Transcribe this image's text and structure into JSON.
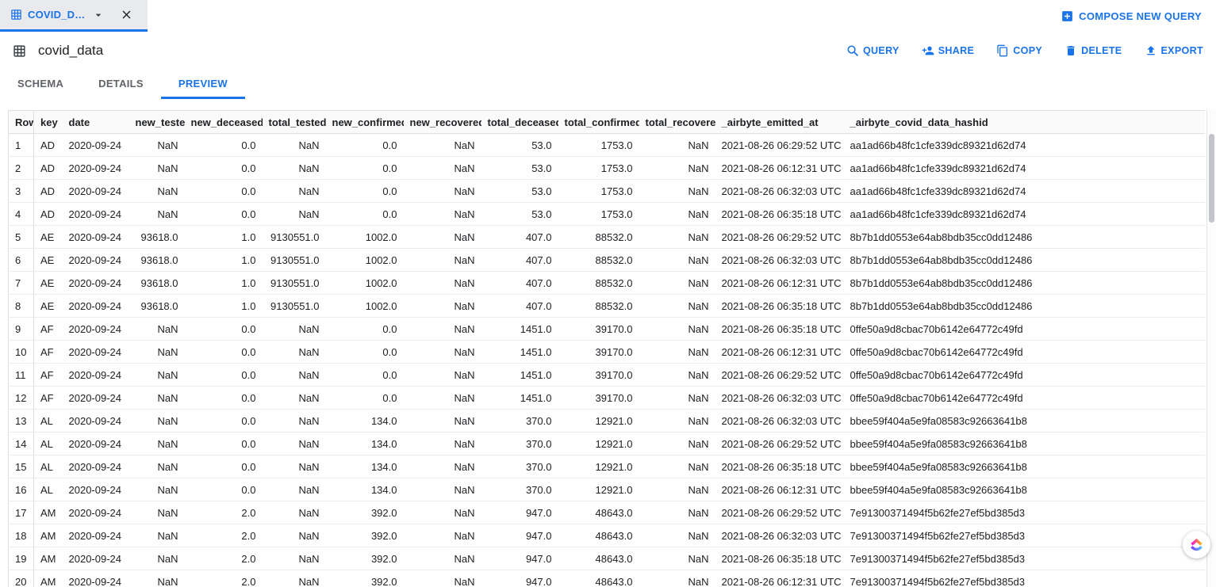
{
  "colors": {
    "accent": "#1a73e8"
  },
  "tab_bar": {
    "tab_label": "COVID_D…",
    "compose_label": "COMPOSE NEW QUERY"
  },
  "header": {
    "title": "covid_data",
    "actions": {
      "query": "QUERY",
      "share": "SHARE",
      "copy": "COPY",
      "delete": "DELETE",
      "export": "EXPORT"
    }
  },
  "nav_tabs": {
    "schema": "SCHEMA",
    "details": "DETAILS",
    "preview": "PREVIEW",
    "active": "PREVIEW"
  },
  "table": {
    "columns": [
      "Row",
      "key",
      "date",
      "new_tested",
      "new_deceased",
      "total_tested",
      "new_confirmed",
      "new_recovered",
      "total_deceased",
      "total_confirmed",
      "total_recovered",
      "_airbyte_emitted_at",
      "_airbyte_covid_data_hashid"
    ],
    "rows": [
      [
        "1",
        "AD",
        "2020-09-24",
        "NaN",
        "0.0",
        "NaN",
        "0.0",
        "NaN",
        "53.0",
        "1753.0",
        "NaN",
        "2021-08-26 06:29:52 UTC",
        "aa1ad66b48fc1cfe339dc89321d62d74"
      ],
      [
        "2",
        "AD",
        "2020-09-24",
        "NaN",
        "0.0",
        "NaN",
        "0.0",
        "NaN",
        "53.0",
        "1753.0",
        "NaN",
        "2021-08-26 06:12:31 UTC",
        "aa1ad66b48fc1cfe339dc89321d62d74"
      ],
      [
        "3",
        "AD",
        "2020-09-24",
        "NaN",
        "0.0",
        "NaN",
        "0.0",
        "NaN",
        "53.0",
        "1753.0",
        "NaN",
        "2021-08-26 06:32:03 UTC",
        "aa1ad66b48fc1cfe339dc89321d62d74"
      ],
      [
        "4",
        "AD",
        "2020-09-24",
        "NaN",
        "0.0",
        "NaN",
        "0.0",
        "NaN",
        "53.0",
        "1753.0",
        "NaN",
        "2021-08-26 06:35:18 UTC",
        "aa1ad66b48fc1cfe339dc89321d62d74"
      ],
      [
        "5",
        "AE",
        "2020-09-24",
        "93618.0",
        "1.0",
        "9130551.0",
        "1002.0",
        "NaN",
        "407.0",
        "88532.0",
        "NaN",
        "2021-08-26 06:29:52 UTC",
        "8b7b1dd0553e64ab8bdb35cc0dd12486"
      ],
      [
        "6",
        "AE",
        "2020-09-24",
        "93618.0",
        "1.0",
        "9130551.0",
        "1002.0",
        "NaN",
        "407.0",
        "88532.0",
        "NaN",
        "2021-08-26 06:32:03 UTC",
        "8b7b1dd0553e64ab8bdb35cc0dd12486"
      ],
      [
        "7",
        "AE",
        "2020-09-24",
        "93618.0",
        "1.0",
        "9130551.0",
        "1002.0",
        "NaN",
        "407.0",
        "88532.0",
        "NaN",
        "2021-08-26 06:12:31 UTC",
        "8b7b1dd0553e64ab8bdb35cc0dd12486"
      ],
      [
        "8",
        "AE",
        "2020-09-24",
        "93618.0",
        "1.0",
        "9130551.0",
        "1002.0",
        "NaN",
        "407.0",
        "88532.0",
        "NaN",
        "2021-08-26 06:35:18 UTC",
        "8b7b1dd0553e64ab8bdb35cc0dd12486"
      ],
      [
        "9",
        "AF",
        "2020-09-24",
        "NaN",
        "0.0",
        "NaN",
        "0.0",
        "NaN",
        "1451.0",
        "39170.0",
        "NaN",
        "2021-08-26 06:35:18 UTC",
        "0ffe50a9d8cbac70b6142e64772c49fd"
      ],
      [
        "10",
        "AF",
        "2020-09-24",
        "NaN",
        "0.0",
        "NaN",
        "0.0",
        "NaN",
        "1451.0",
        "39170.0",
        "NaN",
        "2021-08-26 06:12:31 UTC",
        "0ffe50a9d8cbac70b6142e64772c49fd"
      ],
      [
        "11",
        "AF",
        "2020-09-24",
        "NaN",
        "0.0",
        "NaN",
        "0.0",
        "NaN",
        "1451.0",
        "39170.0",
        "NaN",
        "2021-08-26 06:29:52 UTC",
        "0ffe50a9d8cbac70b6142e64772c49fd"
      ],
      [
        "12",
        "AF",
        "2020-09-24",
        "NaN",
        "0.0",
        "NaN",
        "0.0",
        "NaN",
        "1451.0",
        "39170.0",
        "NaN",
        "2021-08-26 06:32:03 UTC",
        "0ffe50a9d8cbac70b6142e64772c49fd"
      ],
      [
        "13",
        "AL",
        "2020-09-24",
        "NaN",
        "0.0",
        "NaN",
        "134.0",
        "NaN",
        "370.0",
        "12921.0",
        "NaN",
        "2021-08-26 06:32:03 UTC",
        "bbee59f404a5e9fa08583c92663641b8"
      ],
      [
        "14",
        "AL",
        "2020-09-24",
        "NaN",
        "0.0",
        "NaN",
        "134.0",
        "NaN",
        "370.0",
        "12921.0",
        "NaN",
        "2021-08-26 06:29:52 UTC",
        "bbee59f404a5e9fa08583c92663641b8"
      ],
      [
        "15",
        "AL",
        "2020-09-24",
        "NaN",
        "0.0",
        "NaN",
        "134.0",
        "NaN",
        "370.0",
        "12921.0",
        "NaN",
        "2021-08-26 06:35:18 UTC",
        "bbee59f404a5e9fa08583c92663641b8"
      ],
      [
        "16",
        "AL",
        "2020-09-24",
        "NaN",
        "0.0",
        "NaN",
        "134.0",
        "NaN",
        "370.0",
        "12921.0",
        "NaN",
        "2021-08-26 06:12:31 UTC",
        "bbee59f404a5e9fa08583c92663641b8"
      ],
      [
        "17",
        "AM",
        "2020-09-24",
        "NaN",
        "2.0",
        "NaN",
        "392.0",
        "NaN",
        "947.0",
        "48643.0",
        "NaN",
        "2021-08-26 06:29:52 UTC",
        "7e91300371494f5b62fe27ef5bd385d3"
      ],
      [
        "18",
        "AM",
        "2020-09-24",
        "NaN",
        "2.0",
        "NaN",
        "392.0",
        "NaN",
        "947.0",
        "48643.0",
        "NaN",
        "2021-08-26 06:32:03 UTC",
        "7e91300371494f5b62fe27ef5bd385d3"
      ],
      [
        "19",
        "AM",
        "2020-09-24",
        "NaN",
        "2.0",
        "NaN",
        "392.0",
        "NaN",
        "947.0",
        "48643.0",
        "NaN",
        "2021-08-26 06:35:18 UTC",
        "7e91300371494f5b62fe27ef5bd385d3"
      ],
      [
        "20",
        "AM",
        "2020-09-24",
        "NaN",
        "2.0",
        "NaN",
        "392.0",
        "NaN",
        "947.0",
        "48643.0",
        "NaN",
        "2021-08-26 06:12:31 UTC",
        "7e91300371494f5b62fe27ef5bd385d3"
      ]
    ]
  }
}
